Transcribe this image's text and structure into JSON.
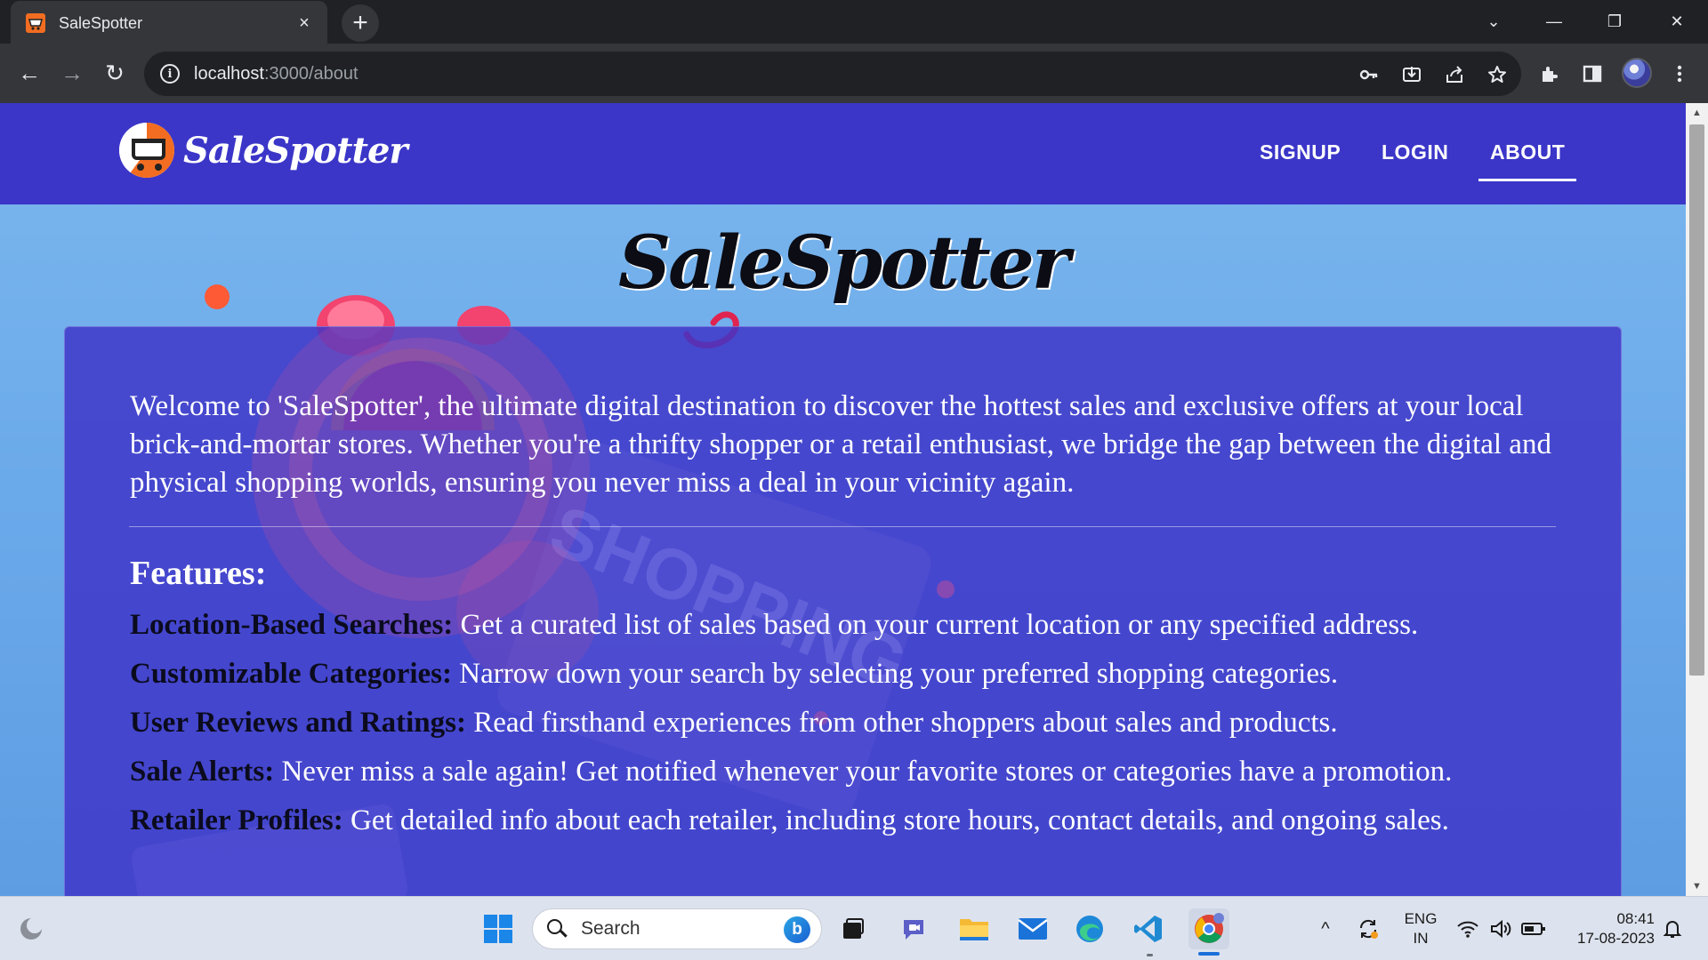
{
  "browser": {
    "tab_title": "SaleSpotter",
    "tab_close": "×",
    "new_tab": "+",
    "url_host": "localhost",
    "url_path": ":3000/about",
    "back": "←",
    "forward": "→",
    "reload": "↻",
    "window_controls": {
      "tab_search": "⌄",
      "minimize": "—",
      "restore": "❐",
      "close": "✕"
    },
    "toolbar_icons": [
      "key-icon",
      "install-icon",
      "share-icon",
      "star-icon",
      "extensions-icon",
      "side-panel-icon",
      "profile-avatar",
      "menu-icon"
    ]
  },
  "app": {
    "brand": "SaleSpotter",
    "nav": [
      {
        "label": "SIGNUP"
      },
      {
        "label": "LOGIN"
      },
      {
        "label": "ABOUT",
        "active": true
      }
    ],
    "hero_title": "SaleSpotter",
    "intro": "Welcome to 'SaleSpotter', the ultimate digital destination to discover the hottest sales and exclusive offers at your local brick-and-mortar stores. Whether you're a thrifty shopper or a retail enthusiast, we bridge the gap between the digital and physical shopping worlds, ensuring you never miss a deal in your vicinity again.",
    "features_heading": "Features:",
    "features": [
      {
        "name": "Location-Based Searches:",
        "text": " Get a curated list of sales based on your current location or any specified address."
      },
      {
        "name": "Customizable Categories:",
        "text": " Narrow down your search by selecting your preferred shopping categories."
      },
      {
        "name": "User Reviews and Ratings:",
        "text": " Read firsthand experiences from other shoppers about sales and products."
      },
      {
        "name": "Sale Alerts:",
        "text": " Never miss a sale again! Get notified whenever your favorite stores or categories have a promotion."
      },
      {
        "name": "Retailer Profiles:",
        "text": " Get detailed info about each retailer, including store hours, contact details, and ongoing sales."
      }
    ],
    "colors": {
      "navbar": "#3b36c8",
      "background": "#6aa9ea",
      "card": "#3e34c8"
    }
  },
  "taskbar": {
    "search_placeholder": "Search",
    "bing": "b",
    "language": "ENG",
    "region": "IN",
    "time": "08:41",
    "date": "17-08-2023",
    "tray_chevron": "^"
  }
}
